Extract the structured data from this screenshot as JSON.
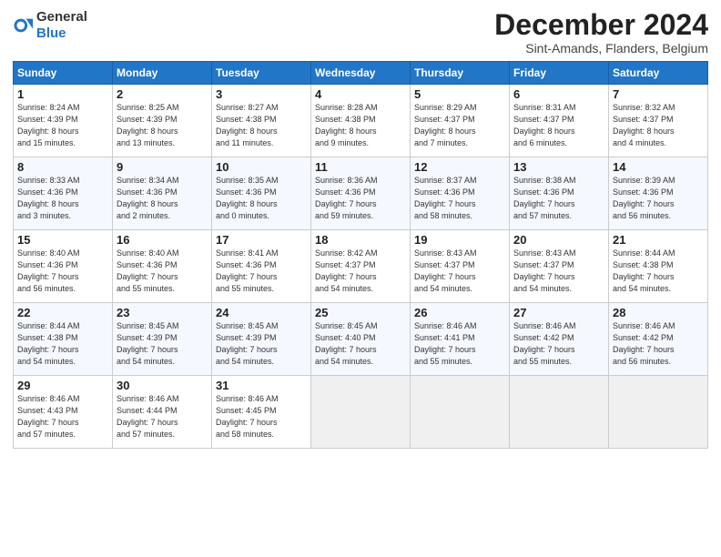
{
  "header": {
    "logo_general": "General",
    "logo_blue": "Blue",
    "month_title": "December 2024",
    "location": "Sint-Amands, Flanders, Belgium"
  },
  "days_of_week": [
    "Sunday",
    "Monday",
    "Tuesday",
    "Wednesday",
    "Thursday",
    "Friday",
    "Saturday"
  ],
  "weeks": [
    [
      {
        "day": "1",
        "detail": "Sunrise: 8:24 AM\nSunset: 4:39 PM\nDaylight: 8 hours\nand 15 minutes."
      },
      {
        "day": "2",
        "detail": "Sunrise: 8:25 AM\nSunset: 4:39 PM\nDaylight: 8 hours\nand 13 minutes."
      },
      {
        "day": "3",
        "detail": "Sunrise: 8:27 AM\nSunset: 4:38 PM\nDaylight: 8 hours\nand 11 minutes."
      },
      {
        "day": "4",
        "detail": "Sunrise: 8:28 AM\nSunset: 4:38 PM\nDaylight: 8 hours\nand 9 minutes."
      },
      {
        "day": "5",
        "detail": "Sunrise: 8:29 AM\nSunset: 4:37 PM\nDaylight: 8 hours\nand 7 minutes."
      },
      {
        "day": "6",
        "detail": "Sunrise: 8:31 AM\nSunset: 4:37 PM\nDaylight: 8 hours\nand 6 minutes."
      },
      {
        "day": "7",
        "detail": "Sunrise: 8:32 AM\nSunset: 4:37 PM\nDaylight: 8 hours\nand 4 minutes."
      }
    ],
    [
      {
        "day": "8",
        "detail": "Sunrise: 8:33 AM\nSunset: 4:36 PM\nDaylight: 8 hours\nand 3 minutes."
      },
      {
        "day": "9",
        "detail": "Sunrise: 8:34 AM\nSunset: 4:36 PM\nDaylight: 8 hours\nand 2 minutes."
      },
      {
        "day": "10",
        "detail": "Sunrise: 8:35 AM\nSunset: 4:36 PM\nDaylight: 8 hours\nand 0 minutes."
      },
      {
        "day": "11",
        "detail": "Sunrise: 8:36 AM\nSunset: 4:36 PM\nDaylight: 7 hours\nand 59 minutes."
      },
      {
        "day": "12",
        "detail": "Sunrise: 8:37 AM\nSunset: 4:36 PM\nDaylight: 7 hours\nand 58 minutes."
      },
      {
        "day": "13",
        "detail": "Sunrise: 8:38 AM\nSunset: 4:36 PM\nDaylight: 7 hours\nand 57 minutes."
      },
      {
        "day": "14",
        "detail": "Sunrise: 8:39 AM\nSunset: 4:36 PM\nDaylight: 7 hours\nand 56 minutes."
      }
    ],
    [
      {
        "day": "15",
        "detail": "Sunrise: 8:40 AM\nSunset: 4:36 PM\nDaylight: 7 hours\nand 56 minutes."
      },
      {
        "day": "16",
        "detail": "Sunrise: 8:40 AM\nSunset: 4:36 PM\nDaylight: 7 hours\nand 55 minutes."
      },
      {
        "day": "17",
        "detail": "Sunrise: 8:41 AM\nSunset: 4:36 PM\nDaylight: 7 hours\nand 55 minutes."
      },
      {
        "day": "18",
        "detail": "Sunrise: 8:42 AM\nSunset: 4:37 PM\nDaylight: 7 hours\nand 54 minutes."
      },
      {
        "day": "19",
        "detail": "Sunrise: 8:43 AM\nSunset: 4:37 PM\nDaylight: 7 hours\nand 54 minutes."
      },
      {
        "day": "20",
        "detail": "Sunrise: 8:43 AM\nSunset: 4:37 PM\nDaylight: 7 hours\nand 54 minutes."
      },
      {
        "day": "21",
        "detail": "Sunrise: 8:44 AM\nSunset: 4:38 PM\nDaylight: 7 hours\nand 54 minutes."
      }
    ],
    [
      {
        "day": "22",
        "detail": "Sunrise: 8:44 AM\nSunset: 4:38 PM\nDaylight: 7 hours\nand 54 minutes."
      },
      {
        "day": "23",
        "detail": "Sunrise: 8:45 AM\nSunset: 4:39 PM\nDaylight: 7 hours\nand 54 minutes."
      },
      {
        "day": "24",
        "detail": "Sunrise: 8:45 AM\nSunset: 4:39 PM\nDaylight: 7 hours\nand 54 minutes."
      },
      {
        "day": "25",
        "detail": "Sunrise: 8:45 AM\nSunset: 4:40 PM\nDaylight: 7 hours\nand 54 minutes."
      },
      {
        "day": "26",
        "detail": "Sunrise: 8:46 AM\nSunset: 4:41 PM\nDaylight: 7 hours\nand 55 minutes."
      },
      {
        "day": "27",
        "detail": "Sunrise: 8:46 AM\nSunset: 4:42 PM\nDaylight: 7 hours\nand 55 minutes."
      },
      {
        "day": "28",
        "detail": "Sunrise: 8:46 AM\nSunset: 4:42 PM\nDaylight: 7 hours\nand 56 minutes."
      }
    ],
    [
      {
        "day": "29",
        "detail": "Sunrise: 8:46 AM\nSunset: 4:43 PM\nDaylight: 7 hours\nand 57 minutes."
      },
      {
        "day": "30",
        "detail": "Sunrise: 8:46 AM\nSunset: 4:44 PM\nDaylight: 7 hours\nand 57 minutes."
      },
      {
        "day": "31",
        "detail": "Sunrise: 8:46 AM\nSunset: 4:45 PM\nDaylight: 7 hours\nand 58 minutes."
      },
      {
        "day": "",
        "detail": ""
      },
      {
        "day": "",
        "detail": ""
      },
      {
        "day": "",
        "detail": ""
      },
      {
        "day": "",
        "detail": ""
      }
    ]
  ]
}
